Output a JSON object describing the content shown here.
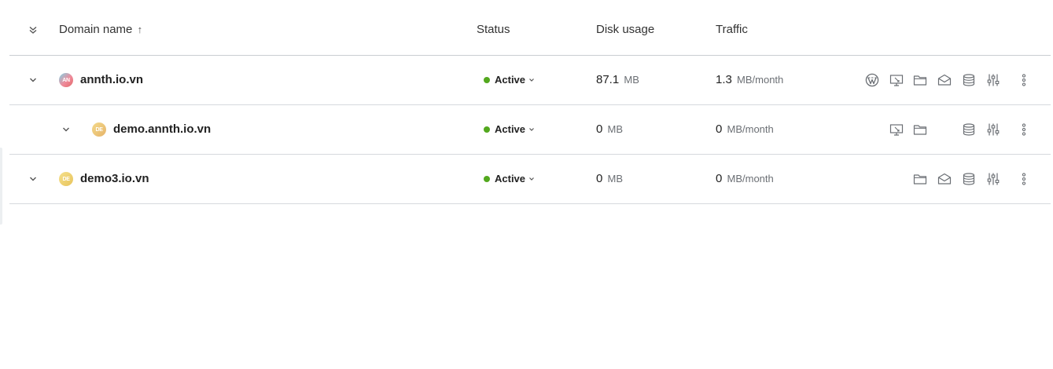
{
  "columns": {
    "domain_name": "Domain name",
    "sort_arrow": "↑",
    "status": "Status",
    "disk_usage": "Disk usage",
    "traffic": "Traffic"
  },
  "colors": {
    "active_dot": "#53a81e",
    "icon_gray": "#6b6f74"
  },
  "rows": [
    {
      "name": "annth.io.vn",
      "favicon_text": "AN",
      "status": "Active",
      "disk_value": "87.1",
      "disk_unit": "MB",
      "traffic_value": "1.3",
      "traffic_unit": "MB/month",
      "actions": [
        "wordpress-icon",
        "website-preview-icon",
        "folder-icon",
        "mail-icon",
        "database-icon",
        "settings-sliders-icon",
        "more-icon"
      ]
    },
    {
      "name": "demo.annth.io.vn",
      "favicon_text": "DE",
      "status": "Active",
      "disk_value": "0",
      "disk_unit": "MB",
      "traffic_value": "0",
      "traffic_unit": "MB/month",
      "actions": [
        "website-preview-icon",
        "folder-icon",
        "database-icon",
        "settings-sliders-icon",
        "more-icon"
      ]
    },
    {
      "name": "demo3.io.vn",
      "favicon_text": "DE",
      "status": "Active",
      "disk_value": "0",
      "disk_unit": "MB",
      "traffic_value": "0",
      "traffic_unit": "MB/month",
      "actions": [
        "folder-icon",
        "mail-icon",
        "database-icon",
        "settings-sliders-icon",
        "more-icon"
      ]
    }
  ]
}
